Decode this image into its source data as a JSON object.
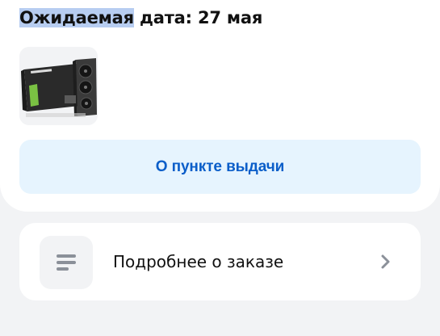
{
  "delivery": {
    "expected_label": "Ожидаемая",
    "date_rest": " дата: 27 мая"
  },
  "product": {
    "thumbnail_icon": "graphics-card-image"
  },
  "pickup": {
    "button_label": "О пункте выдачи"
  },
  "details": {
    "label": "Подробнее о заказе",
    "icon": "lines-icon",
    "chevron_icon": "chevron-right-icon"
  },
  "colors": {
    "page_bg": "#f2f3f5",
    "card_bg": "#ffffff",
    "button_bg": "#e6f4fe",
    "button_text": "#0b5ec9",
    "selection": "#b7cdf1",
    "icon_gray": "#8b9099"
  }
}
